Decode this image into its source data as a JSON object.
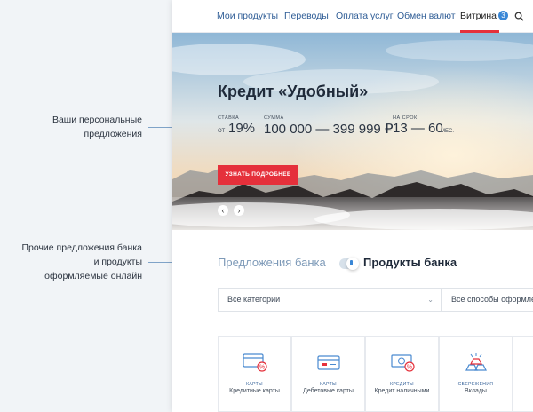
{
  "annotations": {
    "personal_offers": [
      "Ваши персональные",
      "предложения"
    ],
    "other_offers": [
      "Прочие предложения банка",
      "и продукты",
      "оформляемые онлайн"
    ]
  },
  "nav": {
    "items": [
      "Мои продукты",
      "Переводы",
      "Оплата услуг",
      "Обмен валют"
    ],
    "active": "Витрина",
    "active_badge": "3"
  },
  "hero": {
    "title": "Кредит «Удобный»",
    "rate": {
      "label": "СТАВКА",
      "prefix": "ОТ",
      "value": "19%"
    },
    "amount": {
      "label": "СУММА",
      "value": "100 000 — 399 999 ₽"
    },
    "term": {
      "label": "НА СРОК",
      "value": "13 — 60",
      "suffix": "МЕС."
    },
    "button": "УЗНАТЬ ПОДРОБНЕЕ",
    "prev_arrow": "‹",
    "next_arrow": "›"
  },
  "tabs": {
    "bank_offers": "Предложения банка",
    "bank_products": "Продукты банка"
  },
  "filters": {
    "category": "Все категории",
    "method": "Все способы оформления"
  },
  "products": [
    {
      "category": "КАРТЫ",
      "name": "Кредитные карты",
      "icon": "credit-card-percent-icon"
    },
    {
      "category": "КАРТЫ",
      "name": "Дебетовые карты",
      "icon": "debit-card-icon"
    },
    {
      "category": "КРЕДИТЫ",
      "name": "Кредит наличными",
      "icon": "cash-percent-icon"
    },
    {
      "category": "СБЕРЕЖЕНИЯ",
      "name": "Вклады",
      "icon": "gold-bars-icon"
    },
    {
      "category": "",
      "name": "",
      "icon": ""
    }
  ],
  "colors": {
    "accent_red": "#e5303b",
    "link_blue": "#2f5d96",
    "badge_blue": "#3a87d6"
  }
}
